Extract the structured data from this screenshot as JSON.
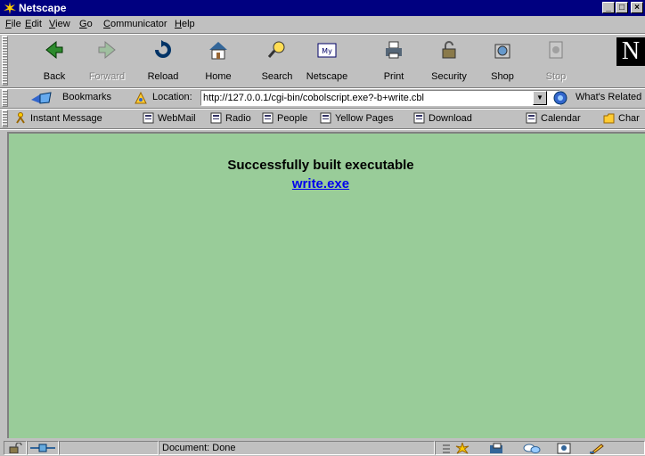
{
  "window": {
    "title": "Netscape"
  },
  "menu": [
    "File",
    "Edit",
    "View",
    "Go",
    "Communicator",
    "Help"
  ],
  "menu_underline": [
    "F",
    "E",
    "V",
    "G",
    "C",
    "H"
  ],
  "navbar": {
    "buttons": [
      {
        "label": "Back",
        "icon": "back-arrow-icon"
      },
      {
        "label": "Forward",
        "icon": "forward-arrow-icon"
      },
      {
        "label": "Reload",
        "icon": "reload-icon"
      },
      {
        "label": "Home",
        "icon": "home-icon"
      },
      {
        "label": "Search",
        "icon": "search-icon"
      },
      {
        "label": "Netscape",
        "icon": "my-netscape-icon"
      },
      {
        "label": "Print",
        "icon": "print-icon"
      },
      {
        "label": "Security",
        "icon": "lock-icon"
      },
      {
        "label": "Shop",
        "icon": "shop-icon"
      },
      {
        "label": "Stop",
        "icon": "stop-icon"
      }
    ],
    "logo": "N"
  },
  "location": {
    "bookmarks_label": "Bookmarks",
    "location_label": "Location:",
    "url": "http://127.0.0.1/cgi-bin/cobolscript.exe?-b+write.cbl",
    "whats_related": "What's Related"
  },
  "personal": [
    "Instant Message",
    "WebMail",
    "Radio",
    "People",
    "Yellow Pages",
    "Download",
    "Calendar",
    "Char"
  ],
  "content": {
    "background": "#99cc99",
    "heading": "Successfully built executable",
    "link": "write.exe"
  },
  "status": {
    "text": "Document: Done"
  }
}
